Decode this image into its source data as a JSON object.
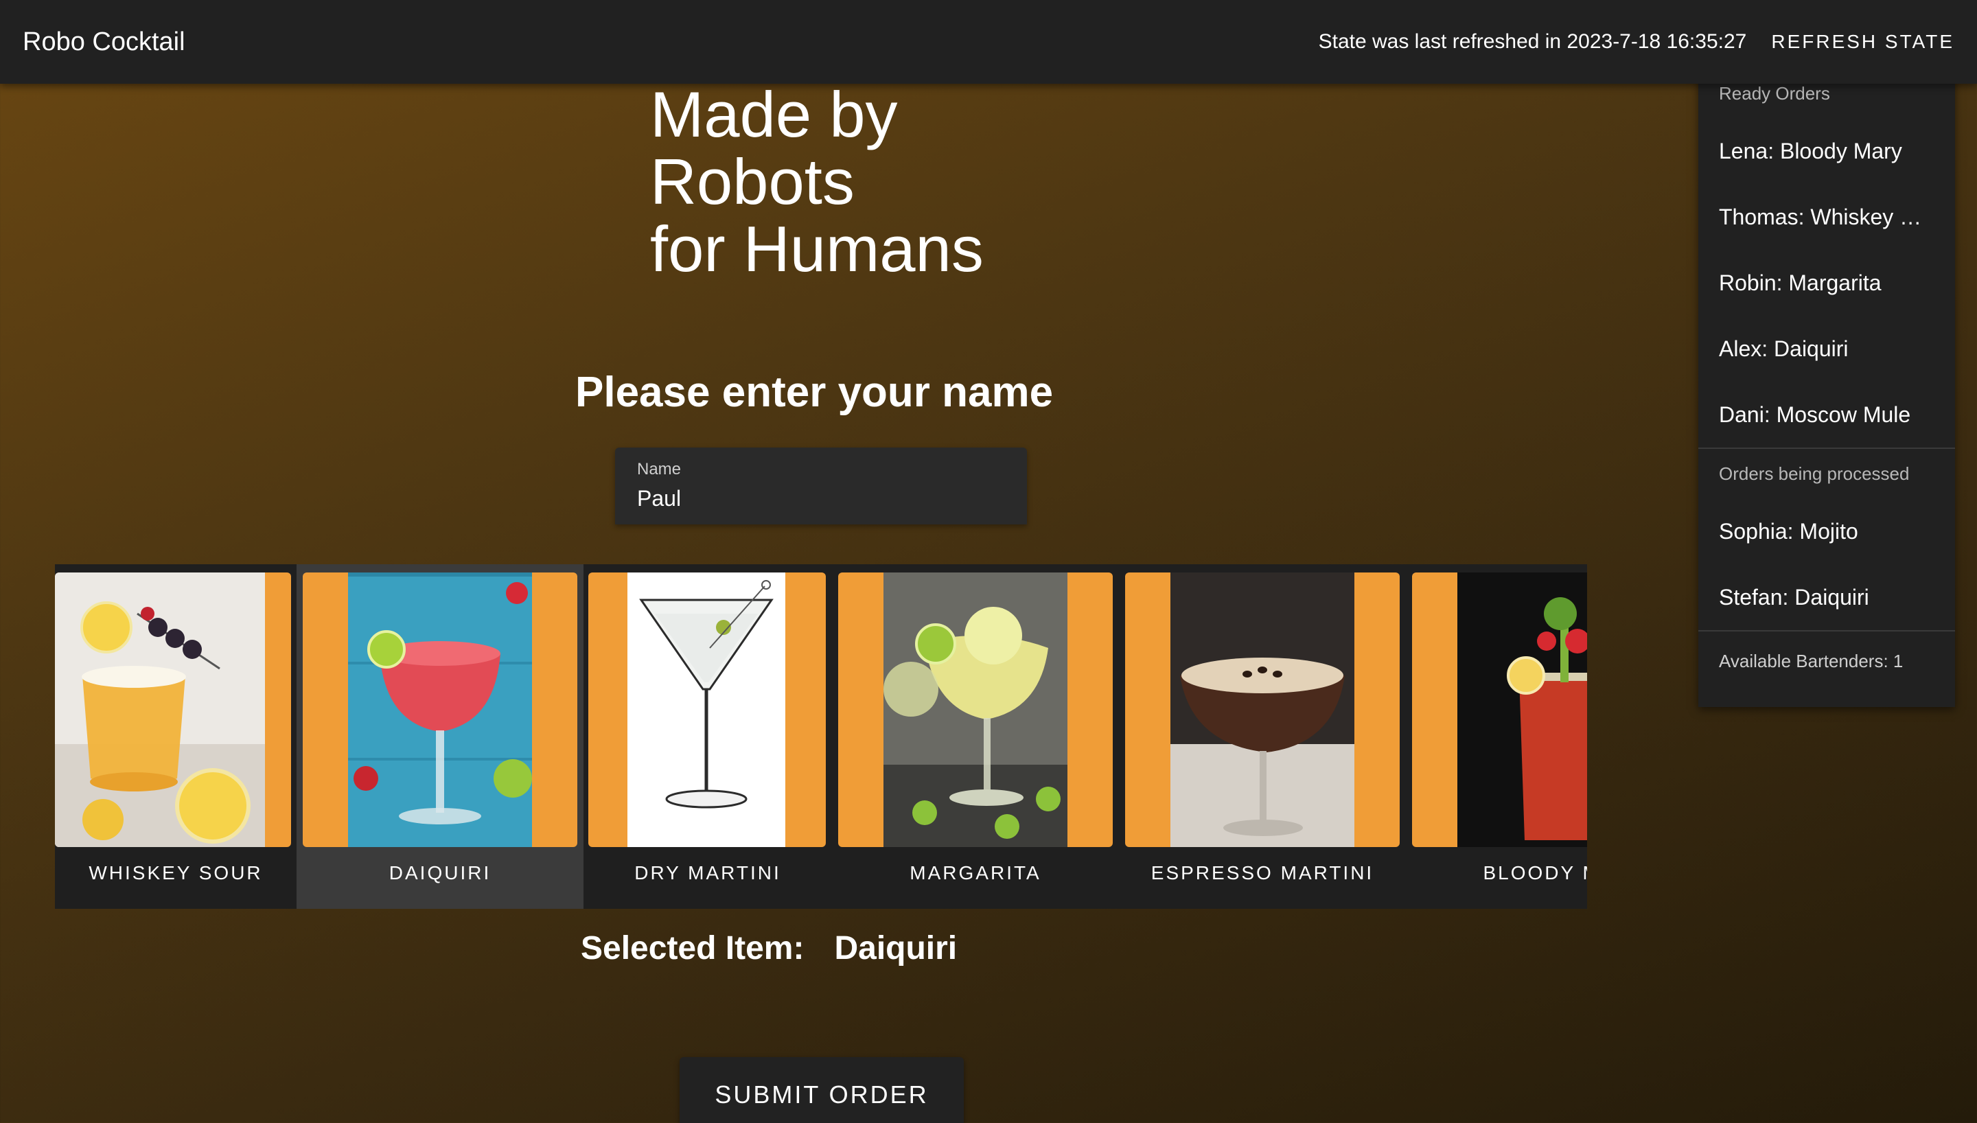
{
  "appbar": {
    "title": "Robo Cocktail",
    "refresh_text": "State was last refreshed in 2023-7-18 16:35:27",
    "refresh_button": "REFRESH STATE"
  },
  "hero": {
    "line1": "Made by",
    "line2": "Robots",
    "line3": "for Humans"
  },
  "form": {
    "prompt": "Please enter your name",
    "name_label": "Name",
    "name_value": "Paul"
  },
  "menu": {
    "items": [
      {
        "label": "WHISKEY SOUR",
        "selected": false
      },
      {
        "label": "DAIQUIRI",
        "selected": true
      },
      {
        "label": "DRY MARTINI",
        "selected": false
      },
      {
        "label": "MARGARITA",
        "selected": false
      },
      {
        "label": "ESPRESSO MARTINI",
        "selected": false
      },
      {
        "label": "BLOODY MA",
        "selected": false
      }
    ]
  },
  "selection": {
    "label": "Selected Item:",
    "value": "Daiquiri"
  },
  "submit_label": "SUBMIT ORDER",
  "orders": {
    "ready_header": "Ready Orders",
    "ready": [
      "Lena: Bloody Mary",
      "Thomas: Whiskey Sour",
      "Robin: Margarita",
      "Alex: Daiquiri",
      "Dani: Moscow Mule"
    ],
    "processing_header": "Orders being processed",
    "processing": [
      "Sophia: Mojito",
      "Stefan: Daiquiri"
    ],
    "available": "Available Bartenders: 1"
  },
  "colors": {
    "accent": "#f09d37",
    "appbar": "#212121",
    "panel": "#212121"
  }
}
